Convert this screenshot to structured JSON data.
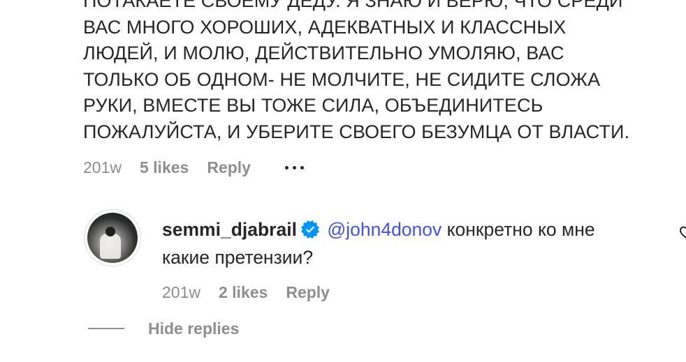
{
  "parent_comment": {
    "lines": [
      "ПОТАКАЕТЕ СВОЕМУ ДЕДУ. Я ЗНАЮ И ВЕРЮ, ЧТО СРЕДИ",
      "ВАС МНОГО ХОРОШИХ, АДЕКВАТНЫХ И КЛАССНЫХ",
      "ЛЮДЕЙ, И МОЛЮ, ДЕЙСТВИТЕЛЬНО УМОЛЯЮ, ВАС",
      "ТОЛЬКО ОБ ОДНОМ- НЕ МОЛЧИТЕ, НЕ СИДИТЕ СЛОЖА",
      "РУКИ, ВМЕСТЕ ВЫ ТОЖЕ СИЛА, ОБЪЕДИНИТЕСЬ",
      "ПОЖАЛУЙСТА, И УБЕРИТЕ СВОЕГО БЕЗУМЦА ОТ ВЛАСТИ."
    ],
    "time": "201w",
    "likes": "5 likes",
    "reply_label": "Reply",
    "more_icon": "more-horizontal-icon"
  },
  "reply_comment": {
    "username": "semmi_djabrail",
    "verified_icon": "verified-badge-icon",
    "mention": "@john4donov",
    "text_line1": "конкретно ко мне",
    "text_line2": "какие претензии?",
    "time": "201w",
    "likes": "2 likes",
    "reply_label": "Reply",
    "like_icon": "heart-icon"
  },
  "hide_replies": {
    "label": "Hide replies"
  },
  "colors": {
    "text": "#262626",
    "secondary": "#8e8e8e",
    "mention": "#4150f7",
    "verified": "#0095f6"
  }
}
